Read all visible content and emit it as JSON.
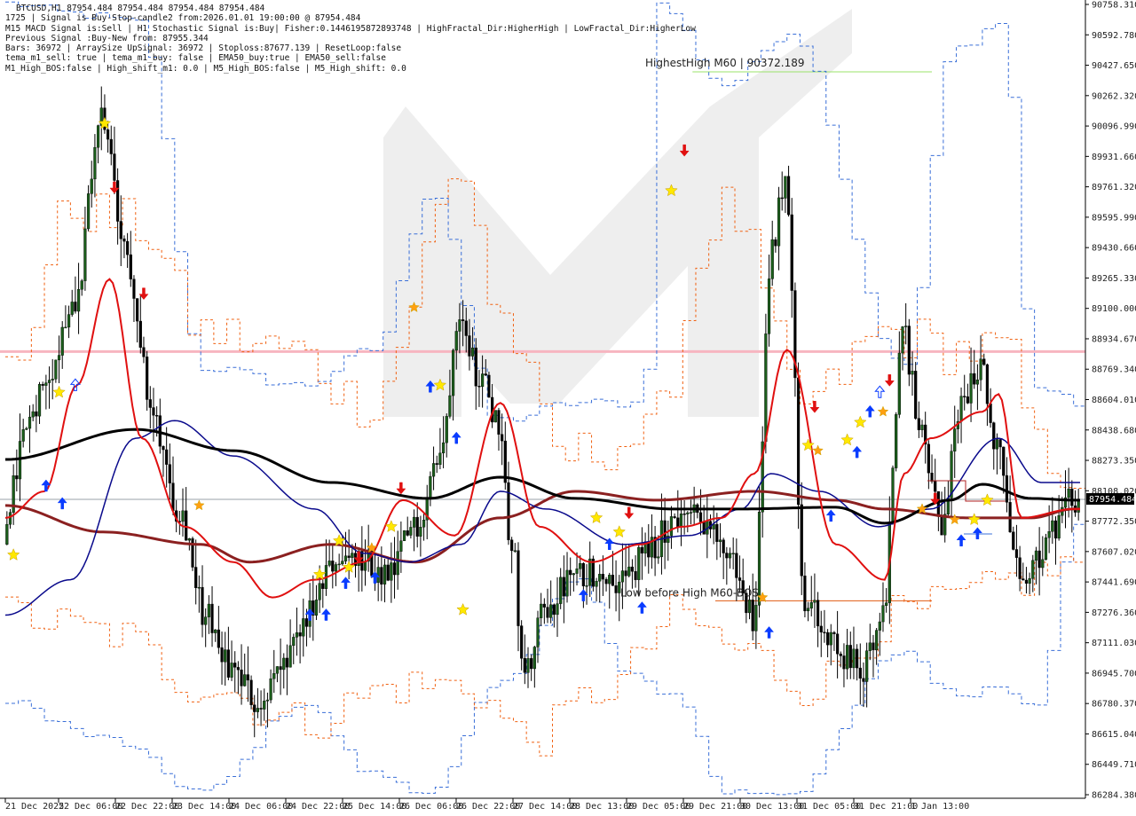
{
  "window": {
    "title": "BTCUSD,H1  87954.484 87954.484 87954.484 87954.484"
  },
  "info_lines": [
    "1725 | Signal is Buy-Stop-candle2 from:2026.01.01 19:00:00 @ 87954.484",
    "M15 MACD Signal is:Sell | H1 Stochastic Signal is:Buy| Fisher:0.1446195872893748 | HighFractal_Dir:HigherHigh | LowFractal_Dir:HigherLow",
    "Previous Signal :Buy-New from: 87955.344",
    "Bars: 36972 | ArraySize UpSignal: 36972 | Stoploss:87677.139 | ResetLoop:false",
    "tema_m1_sell: true | tema_m1_buy: false | EMA50_buy:true | EMA50_sell:false",
    "M1_High_BOS:false | High_shift_m1: 0.0 | M5_High_BOS:false | M5_High_shift: 0.0"
  ],
  "colors": {
    "bull": "#1a5d1a",
    "bear": "#000000",
    "ema_black": "#000000",
    "ema_red": "#e01010",
    "ema_navy": "#0a0a8c",
    "ema_brown": "#8b2020",
    "band_blue": "#3a6fd8",
    "band_orange": "#f06010",
    "pink_level": "#f7b5c0",
    "green_level": "#9be36a",
    "orange_level": "#e05a10",
    "price_tag_bg": "#000000",
    "arrow_up": "#0a3cff",
    "arrow_down": "#e01010",
    "star": "#ffe800",
    "star_orange": "#ffa010"
  },
  "chart_data": {
    "type": "candlestick",
    "symbol": "BTCUSD",
    "timeframe": "H1",
    "ylim": [
      86284.38,
      90758.31
    ],
    "yticks": [
      "90758.310",
      "90592.780",
      "90427.650",
      "90262.320",
      "90096.990",
      "89931.660",
      "89761.320",
      "89595.990",
      "89430.660",
      "89265.330",
      "89100.000",
      "88934.670",
      "88769.340",
      "88604.010",
      "88438.680",
      "88273.350",
      "88108.020",
      "87772.350",
      "87607.020",
      "87441.690",
      "87276.360",
      "87111.030",
      "86945.700",
      "86780.370",
      "86615.040",
      "86449.710",
      "86284.380"
    ],
    "xticks": [
      "21 Dec 2025",
      "22 Dec 06:00",
      "22 Dec 22:00",
      "23 Dec 14:00",
      "24 Dec 06:00",
      "24 Dec 22:00",
      "25 Dec 14:00",
      "26 Dec 06:00",
      "26 Dec 22:00",
      "27 Dec 14:00",
      "28 Dec 13:00",
      "29 Dec 05:00",
      "29 Dec 21:00",
      "30 Dec 13:00",
      "31 Dec 05:00",
      "31 Dec 21:00",
      "1 Jan 13:00"
    ],
    "current_price": "87954.484",
    "levels": [
      {
        "name": "pink-resistance",
        "value": 88790
      },
      {
        "name": "highest-high",
        "value": 90372.189,
        "label": "HighestHigh   M60 | 90372.189"
      },
      {
        "name": "low-before-high",
        "value": 87381,
        "label": "Low before High   M60-BOS"
      }
    ],
    "anchors": [
      [
        0,
        87700
      ],
      [
        6,
        88300
      ],
      [
        14,
        88700
      ],
      [
        22,
        89100
      ],
      [
        30,
        90100
      ],
      [
        38,
        89300
      ],
      [
        46,
        88400
      ],
      [
        54,
        87900
      ],
      [
        62,
        87300
      ],
      [
        70,
        87000
      ],
      [
        78,
        86800
      ],
      [
        86,
        87000
      ],
      [
        94,
        87300
      ],
      [
        102,
        87600
      ],
      [
        110,
        87600
      ],
      [
        118,
        87500
      ],
      [
        126,
        87800
      ],
      [
        134,
        88200
      ],
      [
        140,
        89050
      ],
      [
        146,
        88650
      ],
      [
        152,
        88400
      ],
      [
        156,
        87700
      ],
      [
        160,
        86950
      ],
      [
        166,
        87300
      ],
      [
        174,
        87500
      ],
      [
        182,
        87550
      ],
      [
        190,
        87500
      ],
      [
        198,
        87650
      ],
      [
        206,
        87850
      ],
      [
        214,
        87850
      ],
      [
        222,
        87650
      ],
      [
        230,
        87300
      ],
      [
        236,
        89400
      ],
      [
        240,
        89800
      ],
      [
        246,
        87400
      ],
      [
        252,
        87200
      ],
      [
        258,
        87050
      ],
      [
        264,
        87000
      ],
      [
        270,
        87350
      ],
      [
        276,
        88900
      ],
      [
        282,
        88300
      ],
      [
        288,
        87800
      ],
      [
        294,
        88500
      ],
      [
        300,
        88700
      ],
      [
        306,
        88200
      ],
      [
        312,
        87500
      ],
      [
        318,
        87650
      ],
      [
        324,
        87800
      ],
      [
        328,
        87950
      ]
    ],
    "ema_black": [
      [
        0,
        88180
      ],
      [
        40,
        88350
      ],
      [
        70,
        88230
      ],
      [
        100,
        88050
      ],
      [
        130,
        87960
      ],
      [
        152,
        88080
      ],
      [
        175,
        87960
      ],
      [
        205,
        87900
      ],
      [
        225,
        87900
      ],
      [
        255,
        87910
      ],
      [
        270,
        87820
      ],
      [
        290,
        87950
      ],
      [
        300,
        88040
      ],
      [
        315,
        87960
      ],
      [
        328,
        87950
      ]
    ],
    "ema_red": [
      [
        0,
        87850
      ],
      [
        12,
        88000
      ],
      [
        22,
        88600
      ],
      [
        32,
        89200
      ],
      [
        42,
        88300
      ],
      [
        55,
        87800
      ],
      [
        70,
        87600
      ],
      [
        82,
        87400
      ],
      [
        95,
        87500
      ],
      [
        110,
        87600
      ],
      [
        122,
        87950
      ],
      [
        138,
        87750
      ],
      [
        152,
        88500
      ],
      [
        164,
        87800
      ],
      [
        180,
        87600
      ],
      [
        195,
        87700
      ],
      [
        208,
        87800
      ],
      [
        220,
        87850
      ],
      [
        230,
        88100
      ],
      [
        240,
        88800
      ],
      [
        255,
        87700
      ],
      [
        270,
        87500
      ],
      [
        276,
        88100
      ],
      [
        284,
        88300
      ],
      [
        300,
        88450
      ],
      [
        305,
        88550
      ],
      [
        312,
        87850
      ],
      [
        328,
        87900
      ]
    ],
    "ema_navy": [
      [
        0,
        87300
      ],
      [
        20,
        87500
      ],
      [
        40,
        88300
      ],
      [
        52,
        88400
      ],
      [
        70,
        88200
      ],
      [
        95,
        87900
      ],
      [
        110,
        87650
      ],
      [
        124,
        87600
      ],
      [
        140,
        87700
      ],
      [
        152,
        88000
      ],
      [
        166,
        87900
      ],
      [
        190,
        87700
      ],
      [
        210,
        87750
      ],
      [
        226,
        87900
      ],
      [
        235,
        88100
      ],
      [
        250,
        88000
      ],
      [
        268,
        87800
      ],
      [
        284,
        87900
      ],
      [
        305,
        88300
      ],
      [
        318,
        88050
      ],
      [
        328,
        88050
      ]
    ],
    "ema_brown": [
      [
        0,
        87920
      ],
      [
        30,
        87770
      ],
      [
        60,
        87700
      ],
      [
        75,
        87600
      ],
      [
        100,
        87700
      ],
      [
        126,
        87600
      ],
      [
        152,
        87850
      ],
      [
        175,
        88000
      ],
      [
        200,
        87950
      ],
      [
        230,
        88000
      ],
      [
        255,
        87950
      ],
      [
        270,
        87900
      ],
      [
        295,
        87850
      ],
      [
        315,
        87850
      ],
      [
        328,
        87900
      ]
    ],
    "band_blue_upper": [
      [
        0,
        90758
      ],
      [
        20,
        90700
      ],
      [
        40,
        90650
      ],
      [
        60,
        88700
      ],
      [
        90,
        88600
      ],
      [
        112,
        88800
      ],
      [
        130,
        89700
      ],
      [
        150,
        88400
      ],
      [
        175,
        88500
      ],
      [
        195,
        88500
      ],
      [
        200,
        90750
      ],
      [
        220,
        90300
      ],
      [
        240,
        90600
      ],
      [
        275,
        88700
      ],
      [
        290,
        90500
      ],
      [
        305,
        90650
      ],
      [
        315,
        88600
      ],
      [
        328,
        88500
      ]
    ],
    "band_blue_lower": [
      [
        0,
        86800
      ],
      [
        30,
        86600
      ],
      [
        60,
        86300
      ],
      [
        90,
        86800
      ],
      [
        112,
        86400
      ],
      [
        130,
        86300
      ],
      [
        150,
        86900
      ],
      [
        175,
        87500
      ],
      [
        190,
        86950
      ],
      [
        205,
        86850
      ],
      [
        220,
        86300
      ],
      [
        240,
        86300
      ],
      [
        275,
        87100
      ],
      [
        290,
        86850
      ],
      [
        305,
        86900
      ],
      [
        315,
        86800
      ],
      [
        328,
        87800
      ]
    ],
    "band_orange_upper": [
      [
        0,
        88700
      ],
      [
        20,
        89600
      ],
      [
        40,
        89500
      ],
      [
        60,
        88900
      ],
      [
        85,
        88800
      ],
      [
        110,
        88500
      ],
      [
        140,
        89800
      ],
      [
        150,
        89000
      ],
      [
        170,
        88200
      ],
      [
        195,
        88300
      ],
      [
        220,
        89600
      ],
      [
        245,
        88500
      ],
      [
        270,
        88900
      ],
      [
        290,
        88800
      ],
      [
        305,
        88800
      ],
      [
        318,
        88200
      ],
      [
        328,
        88100
      ]
    ],
    "band_orange_lower": [
      [
        0,
        87300
      ],
      [
        30,
        87200
      ],
      [
        60,
        86900
      ],
      [
        90,
        86700
      ],
      [
        120,
        86900
      ],
      [
        140,
        86900
      ],
      [
        160,
        86600
      ],
      [
        185,
        86900
      ],
      [
        205,
        87300
      ],
      [
        225,
        87100
      ],
      [
        245,
        86900
      ],
      [
        275,
        87300
      ],
      [
        295,
        87400
      ],
      [
        310,
        87500
      ],
      [
        328,
        87600
      ]
    ],
    "markers": [
      {
        "type": "star",
        "bar": 2,
        "price": 87640
      },
      {
        "type": "arrow_up",
        "bar": 12,
        "price": 88030
      },
      {
        "type": "arrow_up",
        "bar": 17,
        "price": 87930
      },
      {
        "type": "star",
        "bar": 16,
        "price": 88560
      },
      {
        "type": "hollow_up",
        "bar": 21,
        "price": 88600
      },
      {
        "type": "star",
        "bar": 30,
        "price": 90080
      },
      {
        "type": "arrow_down",
        "bar": 33,
        "price": 89720
      },
      {
        "type": "arrow_down",
        "bar": 42,
        "price": 89120
      },
      {
        "type": "star_orange",
        "bar": 59,
        "price": 87920
      },
      {
        "type": "arrow_up",
        "bar": 93,
        "price": 87300
      },
      {
        "type": "arrow_up",
        "bar": 98,
        "price": 87300
      },
      {
        "type": "star",
        "bar": 96,
        "price": 87530
      },
      {
        "type": "star",
        "bar": 102,
        "price": 87720
      },
      {
        "type": "star",
        "bar": 105,
        "price": 87570
      },
      {
        "type": "arrow_up",
        "bar": 104,
        "price": 87480
      },
      {
        "type": "arrow_down",
        "bar": 108,
        "price": 87630
      },
      {
        "type": "arrow_up",
        "bar": 113,
        "price": 87510
      },
      {
        "type": "star_orange",
        "bar": 112,
        "price": 87680
      },
      {
        "type": "star",
        "bar": 118,
        "price": 87800
      },
      {
        "type": "arrow_down",
        "bar": 121,
        "price": 88020
      },
      {
        "type": "star_orange",
        "bar": 125,
        "price": 89040
      },
      {
        "type": "arrow_up",
        "bar": 130,
        "price": 88590
      },
      {
        "type": "star",
        "bar": 133,
        "price": 88600
      },
      {
        "type": "arrow_up",
        "bar": 138,
        "price": 88300
      },
      {
        "type": "star",
        "bar": 140,
        "price": 87330
      },
      {
        "type": "arrow_up",
        "bar": 177,
        "price": 87410
      },
      {
        "type": "star",
        "bar": 181,
        "price": 87850
      },
      {
        "type": "arrow_up",
        "bar": 185,
        "price": 87700
      },
      {
        "type": "star",
        "bar": 188,
        "price": 87770
      },
      {
        "type": "arrow_down",
        "bar": 191,
        "price": 87880
      },
      {
        "type": "arrow_up",
        "bar": 195,
        "price": 87340
      },
      {
        "type": "arrow_down",
        "bar": 208,
        "price": 89930
      },
      {
        "type": "star",
        "bar": 204,
        "price": 89700
      },
      {
        "type": "arrow_up",
        "bar": 234,
        "price": 87200
      },
      {
        "type": "star_orange",
        "bar": 232,
        "price": 87400
      },
      {
        "type": "star",
        "bar": 246,
        "price": 88260
      },
      {
        "type": "star_orange",
        "bar": 249,
        "price": 88230
      },
      {
        "type": "arrow_down",
        "bar": 248,
        "price": 88480
      },
      {
        "type": "arrow_up",
        "bar": 253,
        "price": 87860
      },
      {
        "type": "star",
        "bar": 258,
        "price": 88290
      },
      {
        "type": "arrow_up",
        "bar": 261,
        "price": 88220
      },
      {
        "type": "star",
        "bar": 262,
        "price": 88390
      },
      {
        "type": "arrow_up",
        "bar": 265,
        "price": 88450
      },
      {
        "type": "hollow_up",
        "bar": 268,
        "price": 88560
      },
      {
        "type": "arrow_down",
        "bar": 271,
        "price": 88630
      },
      {
        "type": "star_orange",
        "bar": 269,
        "price": 88450
      },
      {
        "type": "star_orange",
        "bar": 281,
        "price": 87900
      },
      {
        "type": "arrow_down",
        "bar": 285,
        "price": 87960
      },
      {
        "type": "star_orange",
        "bar": 291,
        "price": 87840
      },
      {
        "type": "arrow_up",
        "bar": 293,
        "price": 87720
      },
      {
        "type": "star",
        "bar": 297,
        "price": 87840
      },
      {
        "type": "arrow_up",
        "bar": 298,
        "price": 87760
      },
      {
        "type": "star",
        "bar": 301,
        "price": 87950
      }
    ]
  }
}
